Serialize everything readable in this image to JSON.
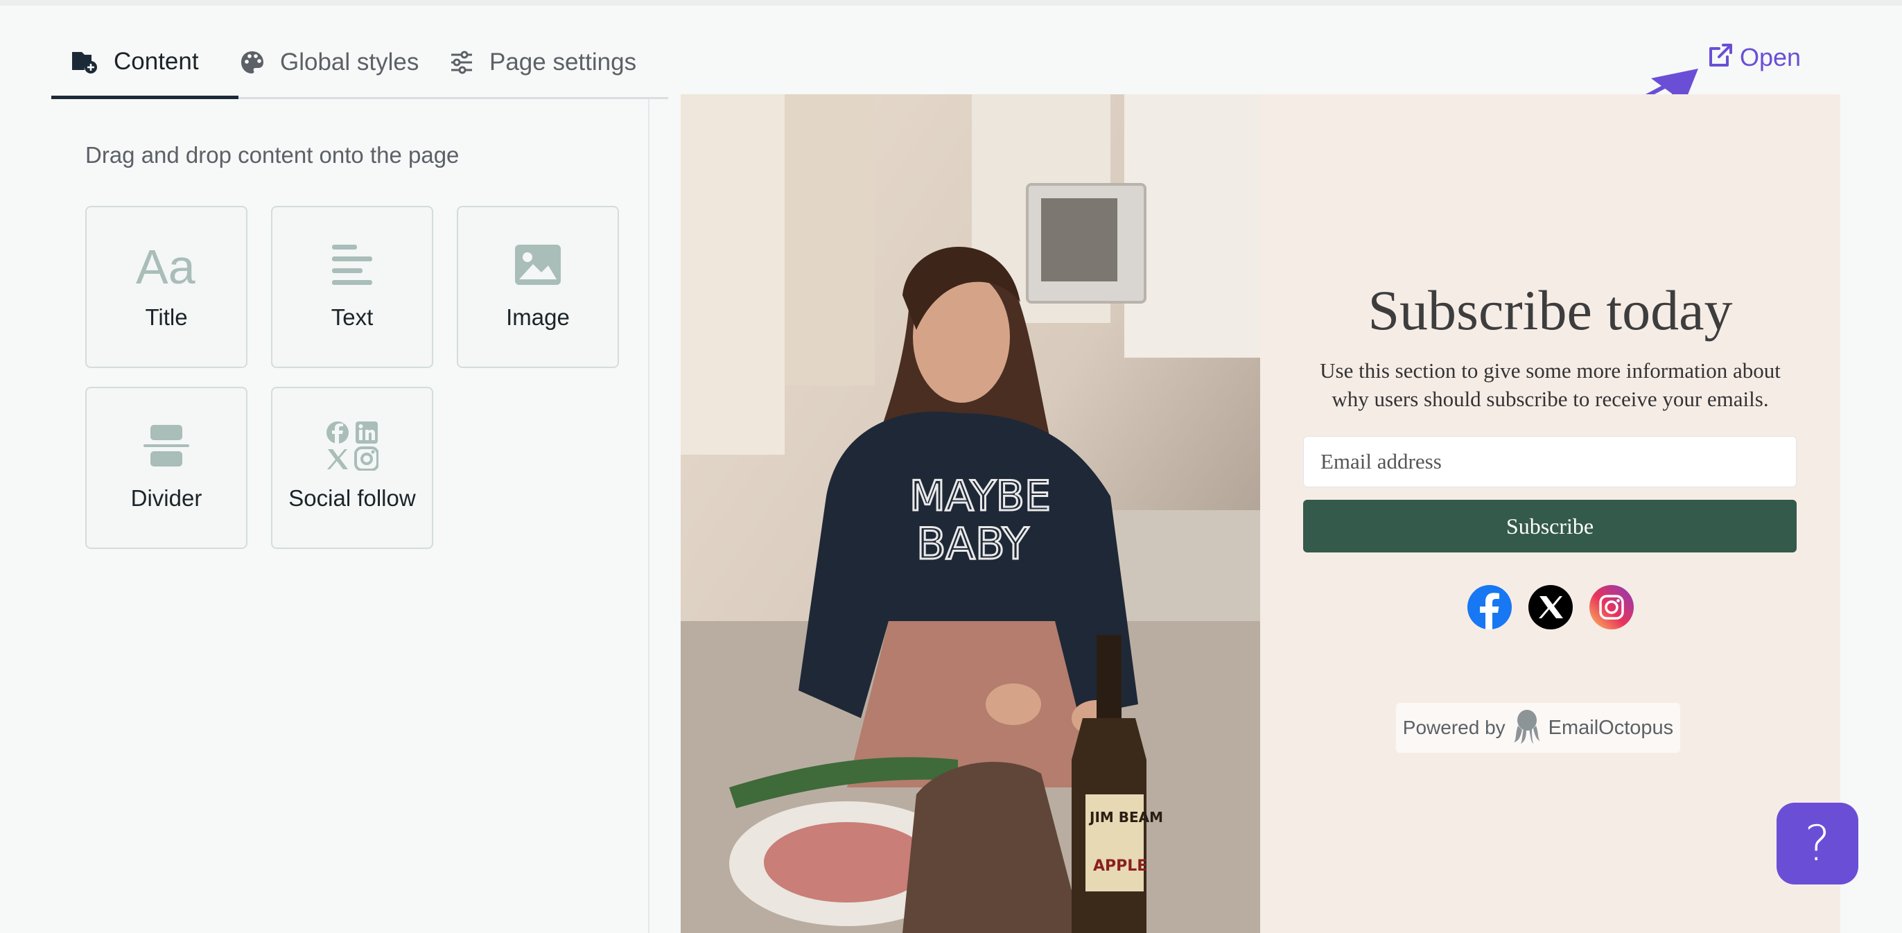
{
  "tabs": [
    {
      "label": "Content",
      "icon": "content-add-icon",
      "active": true
    },
    {
      "label": "Global styles",
      "icon": "palette-icon",
      "active": false
    },
    {
      "label": "Page settings",
      "icon": "sliders-icon",
      "active": false
    }
  ],
  "open_link": {
    "label": "Open",
    "icon": "external-link-icon"
  },
  "left_panel": {
    "hint": "Drag and drop content onto the page",
    "blocks": [
      {
        "label": "Title",
        "icon": "title-aa-icon"
      },
      {
        "label": "Text",
        "icon": "text-lines-icon"
      },
      {
        "label": "Image",
        "icon": "image-icon"
      },
      {
        "label": "Divider",
        "icon": "divider-icon"
      },
      {
        "label": "Social follow",
        "icon": "social-grid-icon"
      }
    ]
  },
  "preview": {
    "title": "Subscribe today",
    "description": "Use this section to give some more information about why users should subscribe to receive your emails.",
    "email_placeholder": "Email address",
    "subscribe_label": "Subscribe",
    "socials": [
      "facebook-icon",
      "x-icon",
      "instagram-icon"
    ],
    "powered_by_label": "Powered by",
    "powered_by_brand": "EmailOctopus",
    "photo_shirt_text": [
      "MAYBE",
      "BABY"
    ],
    "photo_bottle_text": [
      "JIM BEAM",
      "APPLE"
    ]
  },
  "help": {
    "label": "?",
    "icon": "help-icon"
  },
  "colors": {
    "accent": "#6a4fd6",
    "button": "#345a4b",
    "preview_bg": "#f6ece6",
    "tab_active_underline": "#1c2a38"
  }
}
